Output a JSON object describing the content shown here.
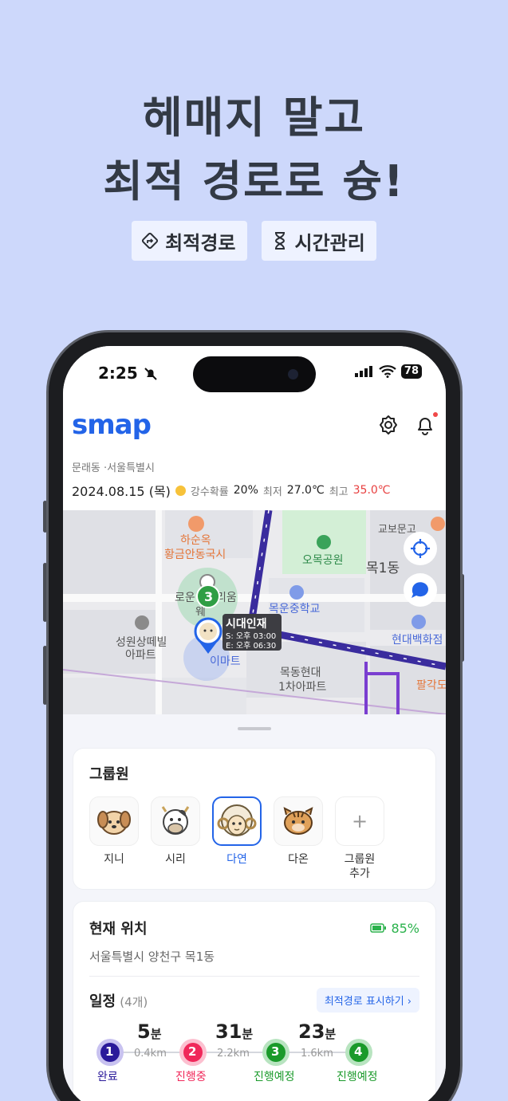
{
  "promo": {
    "headline_line1": "헤매지 말고",
    "headline_line2": "최적 경로로 슝!",
    "chip1": "최적경로",
    "chip2": "시간관리"
  },
  "status_bar": {
    "time": "2:25",
    "battery": "78"
  },
  "app": {
    "logo": "smap"
  },
  "info": {
    "location": "문래동 ·서울특별시",
    "date": "2024.08.15 (목)",
    "rain_label": "강수확률",
    "rain_value": "20%",
    "min_label": "최저",
    "min_value": "27.0℃",
    "max_label": "최고",
    "max_value": "35.0℃"
  },
  "map": {
    "places": [
      "하순옥",
      "황금안동국시",
      "오목공원",
      "목1동",
      "교보문고",
      "목운중학교",
      "성원상떼빌",
      "아파트",
      "이마트",
      "현대백화점",
      "목동현대",
      "1차아파트",
      "팔각도",
      "로운",
      "리움",
      "웨"
    ],
    "marker_count": "3",
    "popup_name": "시대인재",
    "popup_start": "S: 오후 03:00",
    "popup_end": "E: 오후 06:30"
  },
  "members_card": {
    "title": "그룹원",
    "members": [
      {
        "name": "지니",
        "icon": "dog-avatar-icon"
      },
      {
        "name": "시리",
        "icon": "cow-avatar-icon"
      },
      {
        "name": "다연",
        "icon": "sheep-avatar-icon",
        "selected": true
      },
      {
        "name": "다온",
        "icon": "tiger-avatar-icon"
      }
    ],
    "add_label_1": "그룹원",
    "add_label_2": "추가",
    "add_icon": "+"
  },
  "location_card": {
    "title": "현재 위치",
    "battery": "85%",
    "address": "서울특별시 양천구 목1동",
    "schedule_title": "일정",
    "schedule_count": "(4개)",
    "route_button": "최적경로 표시하기 ›",
    "steps": [
      {
        "num": "1",
        "label": "완료",
        "color": "#2a1a9a"
      },
      {
        "num": "2",
        "label": "진행중",
        "color": "#f0285a"
      },
      {
        "num": "3",
        "label": "진행예정",
        "color": "#1a9a2a"
      },
      {
        "num": "4",
        "label": "진행예정",
        "color": "#1a9a2a"
      }
    ],
    "legs": [
      {
        "min": "5",
        "unit": "분",
        "dist": "0.4km"
      },
      {
        "min": "31",
        "unit": "분",
        "dist": "2.2km"
      },
      {
        "min": "23",
        "unit": "분",
        "dist": "1.6km"
      }
    ]
  },
  "colors": {
    "accent": "#2364e8",
    "route": "#3a2c9e",
    "background": "#cdd8fb"
  }
}
